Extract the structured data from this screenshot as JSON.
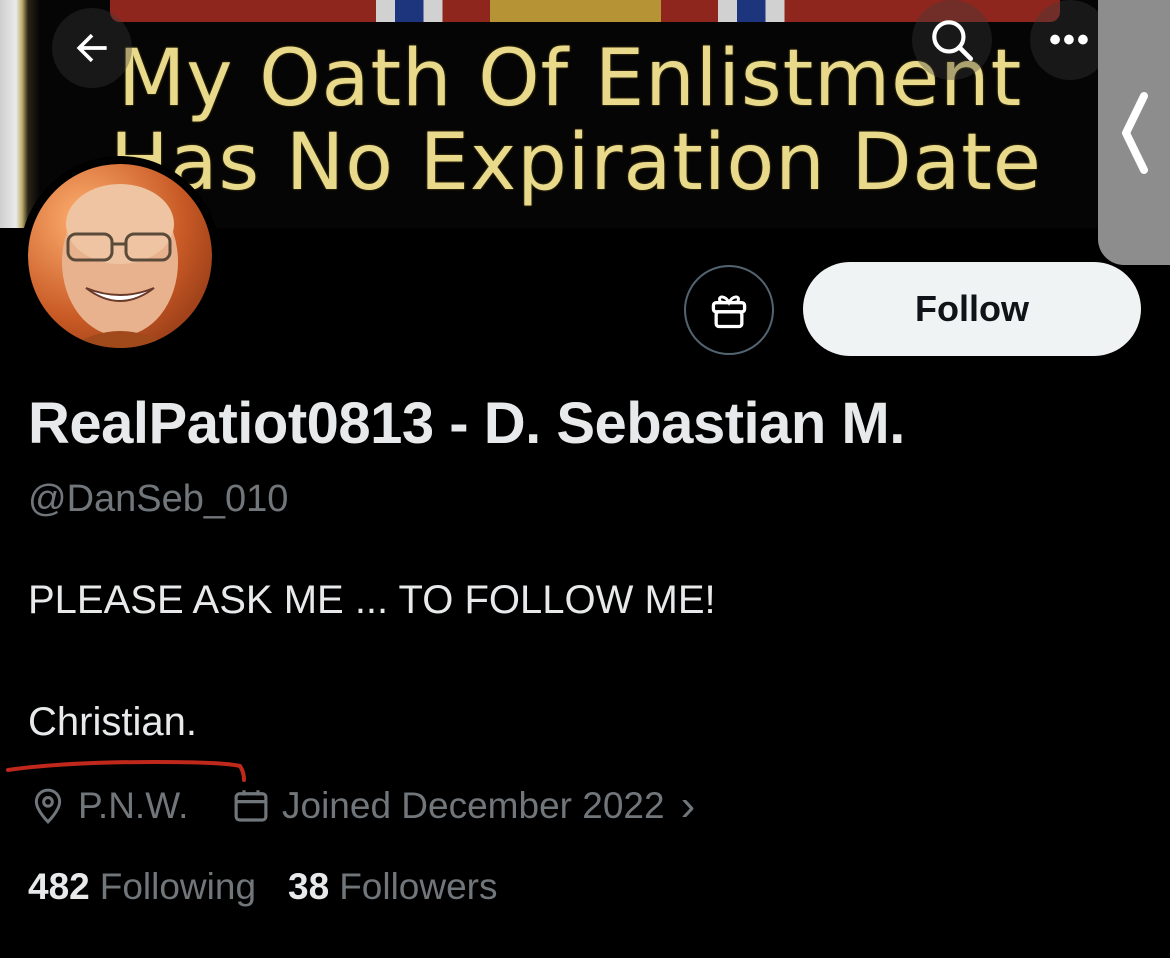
{
  "banner": {
    "line1": "My Oath Of Enlistment",
    "line2": "Has No Expiration Date"
  },
  "header": {
    "back_icon": "arrow-left-icon",
    "search_icon": "search-icon",
    "more_icon": "more-horizontal-icon",
    "more_glyph": "•••"
  },
  "profile": {
    "display_name": "RealPatiot0813 - D. Sebastian M.",
    "handle": "@DanSeb_010",
    "bio_line1": "PLEASE ASK ME ... TO FOLLOW ME!",
    "bio_line2": "Christian.",
    "location": "P.N.W.",
    "joined": "Joined December 2022",
    "joined_chevron": "›"
  },
  "actions": {
    "follow_label": "Follow",
    "gift_icon": "gift-icon"
  },
  "stats": {
    "following_count": "482",
    "following_label": "Following",
    "followers_count": "38",
    "followers_label": "Followers"
  },
  "colors": {
    "background": "#000000",
    "primary_text": "#e7e9ea",
    "secondary_text": "#71767b",
    "follow_button_bg": "#eff3f4",
    "annotation_red": "#c0281c"
  }
}
